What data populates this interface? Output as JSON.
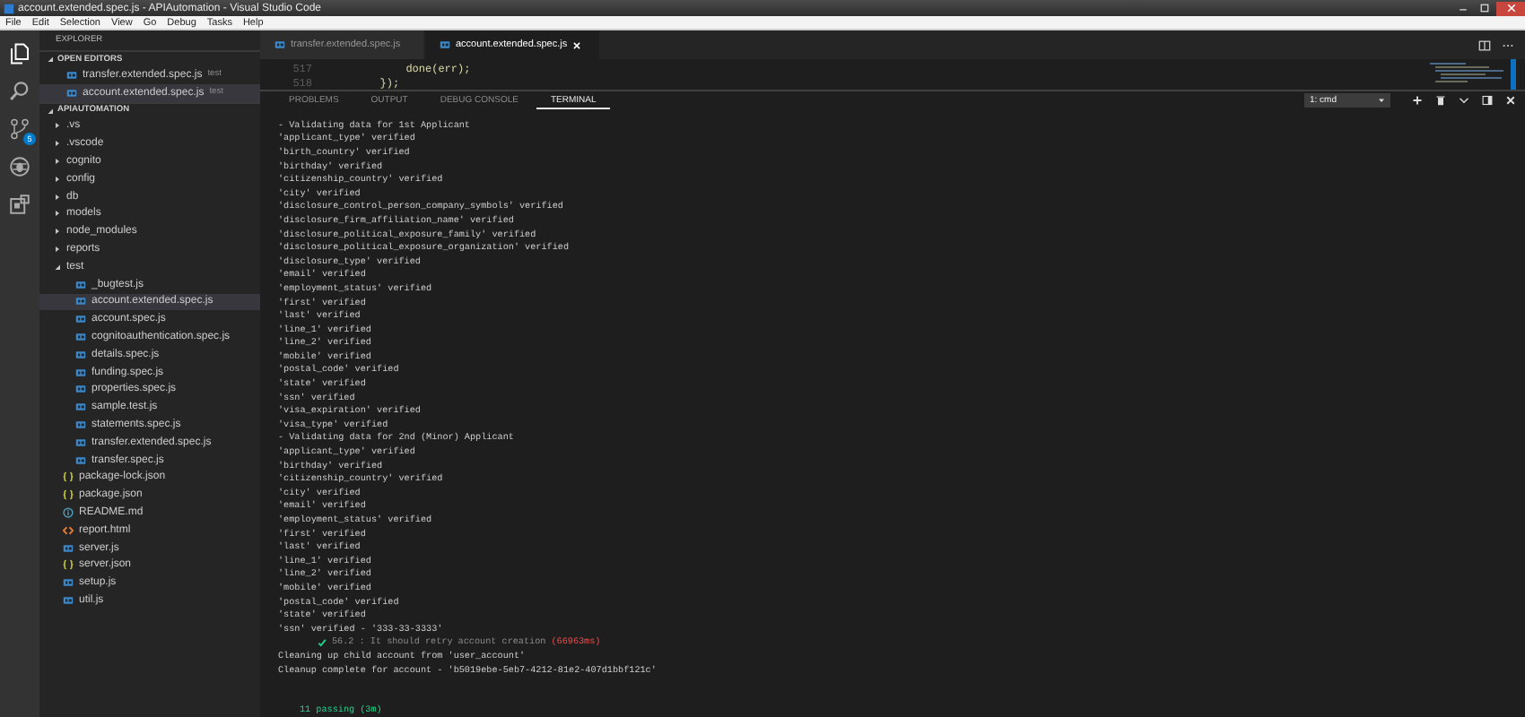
{
  "window": {
    "title": "account.extended.spec.js - APIAutomation - Visual Studio Code"
  },
  "menu": [
    "File",
    "Edit",
    "Selection",
    "View",
    "Go",
    "Debug",
    "Tasks",
    "Help"
  ],
  "activity_bar": {
    "source_control_badge": "5"
  },
  "sidebar": {
    "title": "EXPLORER",
    "open_editors": {
      "title": "OPEN EDITORS",
      "expanded": true,
      "items": [
        {
          "label": "transfer.extended.spec.js",
          "description": "test",
          "kind": "js",
          "selected": false
        },
        {
          "label": "account.extended.spec.js",
          "description": "test",
          "kind": "js",
          "selected": true
        }
      ]
    },
    "tree": {
      "title": "APIAUTOMATION",
      "expanded": true,
      "items": [
        {
          "label": ".vs",
          "kind": "folder",
          "expanded": false,
          "selected": false
        },
        {
          "label": ".vscode",
          "kind": "folder",
          "expanded": false,
          "selected": false
        },
        {
          "label": "cognito",
          "kind": "folder",
          "expanded": false,
          "selected": false
        },
        {
          "label": "config",
          "kind": "folder",
          "expanded": false,
          "selected": false
        },
        {
          "label": "db",
          "kind": "folder",
          "expanded": false,
          "selected": false
        },
        {
          "label": "models",
          "kind": "folder",
          "expanded": false,
          "selected": false
        },
        {
          "label": "node_modules",
          "kind": "folder",
          "expanded": false,
          "selected": false
        },
        {
          "label": "reports",
          "kind": "folder",
          "expanded": false,
          "selected": false
        },
        {
          "label": "test",
          "kind": "folder",
          "expanded": true,
          "selected": false,
          "children": [
            {
              "label": "_bugtest.js",
              "kind": "js",
              "selected": false
            },
            {
              "label": "account.extended.spec.js",
              "kind": "js",
              "selected": true
            },
            {
              "label": "account.spec.js",
              "kind": "js",
              "selected": false
            },
            {
              "label": "cognitoauthentication.spec.js",
              "kind": "js",
              "selected": false
            },
            {
              "label": "details.spec.js",
              "kind": "js",
              "selected": false
            },
            {
              "label": "funding.spec.js",
              "kind": "js",
              "selected": false
            },
            {
              "label": "properties.spec.js",
              "kind": "js",
              "selected": false
            },
            {
              "label": "sample.test.js",
              "kind": "js",
              "selected": false
            },
            {
              "label": "statements.spec.js",
              "kind": "js",
              "selected": false
            },
            {
              "label": "transfer.extended.spec.js",
              "kind": "js",
              "selected": false
            },
            {
              "label": "transfer.spec.js",
              "kind": "js",
              "selected": false
            }
          ]
        },
        {
          "label": "package-lock.json",
          "kind": "json",
          "selected": false
        },
        {
          "label": "package.json",
          "kind": "json",
          "selected": false
        },
        {
          "label": "README.md",
          "kind": "md",
          "selected": false
        },
        {
          "label": "report.html",
          "kind": "html",
          "selected": false
        },
        {
          "label": "server.js",
          "kind": "js",
          "selected": false
        },
        {
          "label": "server.json",
          "kind": "json",
          "selected": false
        },
        {
          "label": "setup.js",
          "kind": "js",
          "selected": false
        },
        {
          "label": "util.js",
          "kind": "js",
          "selected": false
        }
      ]
    }
  },
  "editor": {
    "tabs": [
      {
        "label": "transfer.extended.spec.js",
        "selected": false
      },
      {
        "label": "account.extended.spec.js",
        "selected": true
      }
    ],
    "lines": [
      {
        "number": "517",
        "code": "            done(err);"
      },
      {
        "number": "518",
        "code": "        });"
      }
    ]
  },
  "panel": {
    "tabs": [
      {
        "label": "PROBLEMS",
        "selected": false
      },
      {
        "label": "OUTPUT",
        "selected": false
      },
      {
        "label": "DEBUG CONSOLE",
        "selected": false
      },
      {
        "label": "TERMINAL",
        "selected": true
      }
    ],
    "terminal_select": "1: cmd",
    "terminal_lines": [
      {
        "kind": "text",
        "text": "- Validating data for 1st Applicant"
      },
      {
        "kind": "text",
        "text": "'applicant_type' verified"
      },
      {
        "kind": "text",
        "text": "'birth_country' verified"
      },
      {
        "kind": "text",
        "text": "'birthday' verified"
      },
      {
        "kind": "text",
        "text": "'citizenship_country' verified"
      },
      {
        "kind": "text",
        "text": "'city' verified"
      },
      {
        "kind": "text",
        "text": "'disclosure_control_person_company_symbols' verified"
      },
      {
        "kind": "text",
        "text": "'disclosure_firm_affiliation_name' verified"
      },
      {
        "kind": "text",
        "text": "'disclosure_political_exposure_family' verified"
      },
      {
        "kind": "text",
        "text": "'disclosure_political_exposure_organization' verified"
      },
      {
        "kind": "text",
        "text": "'disclosure_type' verified"
      },
      {
        "kind": "text",
        "text": "'email' verified"
      },
      {
        "kind": "text",
        "text": "'employment_status' verified"
      },
      {
        "kind": "text",
        "text": "'first' verified"
      },
      {
        "kind": "text",
        "text": "'last' verified"
      },
      {
        "kind": "text",
        "text": "'line_1' verified"
      },
      {
        "kind": "text",
        "text": "'line_2' verified"
      },
      {
        "kind": "text",
        "text": "'mobile' verified"
      },
      {
        "kind": "text",
        "text": "'postal_code' verified"
      },
      {
        "kind": "text",
        "text": "'state' verified"
      },
      {
        "kind": "text",
        "text": "'ssn' verified"
      },
      {
        "kind": "text",
        "text": "'visa_expiration' verified"
      },
      {
        "kind": "text",
        "text": "'visa_type' verified"
      },
      {
        "kind": "text",
        "text": "- Validating data for 2nd (Minor) Applicant"
      },
      {
        "kind": "text",
        "text": "'applicant_type' verified"
      },
      {
        "kind": "text",
        "text": "'birthday' verified"
      },
      {
        "kind": "text",
        "text": "'citizenship_country' verified"
      },
      {
        "kind": "text",
        "text": "'city' verified"
      },
      {
        "kind": "text",
        "text": "'email' verified"
      },
      {
        "kind": "text",
        "text": "'employment_status' verified"
      },
      {
        "kind": "text",
        "text": "'first' verified"
      },
      {
        "kind": "text",
        "text": "'last' verified"
      },
      {
        "kind": "text",
        "text": "'line_1' verified"
      },
      {
        "kind": "text",
        "text": "'line_2' verified"
      },
      {
        "kind": "text",
        "text": "'mobile' verified"
      },
      {
        "kind": "text",
        "text": "'postal_code' verified"
      },
      {
        "kind": "text",
        "text": "'state' verified"
      },
      {
        "kind": "text",
        "text": "'ssn' verified - '333-33-3333'"
      },
      {
        "kind": "pass",
        "text": "56.2 : It should retry account creation",
        "duration": "(66963ms)"
      },
      {
        "kind": "text",
        "text": "Cleaning up child account from 'user_account'"
      },
      {
        "kind": "text",
        "text": "Cleanup complete for account - 'b5019ebe-5eb7-4212-81e2-407d1bbf121c'"
      },
      {
        "kind": "blank"
      },
      {
        "kind": "blank"
      },
      {
        "kind": "summary",
        "text": "11 passing (3m)"
      }
    ]
  }
}
